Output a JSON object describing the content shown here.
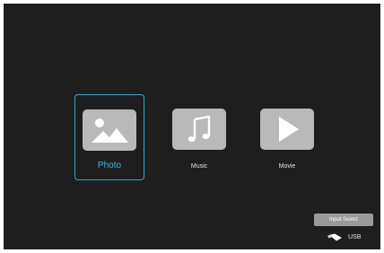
{
  "media_menu": {
    "items": [
      {
        "label": "Photo",
        "icon": "photo-icon",
        "selected": true
      },
      {
        "label": "Music",
        "icon": "music-note-icon",
        "selected": false
      },
      {
        "label": "Movie",
        "icon": "play-icon",
        "selected": false
      }
    ]
  },
  "controls": {
    "input_select_label": "Input Select",
    "source_label": "USB",
    "source_icon": "usb-drive-icon"
  },
  "colors": {
    "background": "#1e1e1e",
    "selection_accent": "#2aa9cf",
    "tile_icon_bg": "#b9b9b9"
  }
}
